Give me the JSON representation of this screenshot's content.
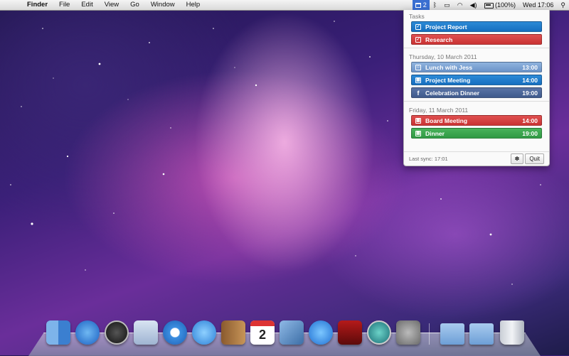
{
  "menubar": {
    "apple_glyph": "",
    "app_name": "Finder",
    "menus": [
      "File",
      "Edit",
      "View",
      "Go",
      "Window",
      "Help"
    ],
    "app_badge": "2",
    "bluetooth_glyph": "ᛒ",
    "wifi_glyph": "◠",
    "volume_glyph": "◀)",
    "battery_text": "(100%)",
    "clock": "Wed 17:06"
  },
  "panel": {
    "tasks_title": "Tasks",
    "tasks": [
      {
        "label": "Project Report",
        "color": "#1a72c4"
      },
      {
        "label": "Research",
        "color": "#cc3636"
      }
    ],
    "days": [
      {
        "title": "Thursday, 10 March 2011",
        "events": [
          {
            "label": "Lunch with Jess",
            "time": "13:00",
            "icon": "person-icon"
          },
          {
            "label": "Project Meeting",
            "time": "14:00",
            "icon": "calendar-icon"
          },
          {
            "label": "Celebration Dinner",
            "time": "19:00",
            "icon": "facebook-icon"
          }
        ]
      },
      {
        "title": "Friday, 11 March 2011",
        "events": [
          {
            "label": "Board Meeting",
            "time": "14:00",
            "icon": "calendar-icon"
          },
          {
            "label": "Dinner",
            "time": "19:00",
            "icon": "calendar-icon"
          }
        ]
      }
    ],
    "footer": {
      "last_sync": "Last sync: 17:01",
      "settings_glyph": "✽",
      "quit_label": "Quit"
    }
  },
  "dock": {
    "ical_day": "2",
    "items": [
      "finder-icon",
      "app-store-icon",
      "dashboard-icon",
      "mail-icon",
      "safari-icon",
      "ichat-icon",
      "address-book-icon",
      "ical-icon",
      "preview-icon",
      "itunes-icon",
      "photo-booth-icon",
      "time-machine-icon",
      "system-preferences-icon",
      "applications-folder-icon",
      "documents-folder-icon",
      "trash-icon"
    ]
  }
}
